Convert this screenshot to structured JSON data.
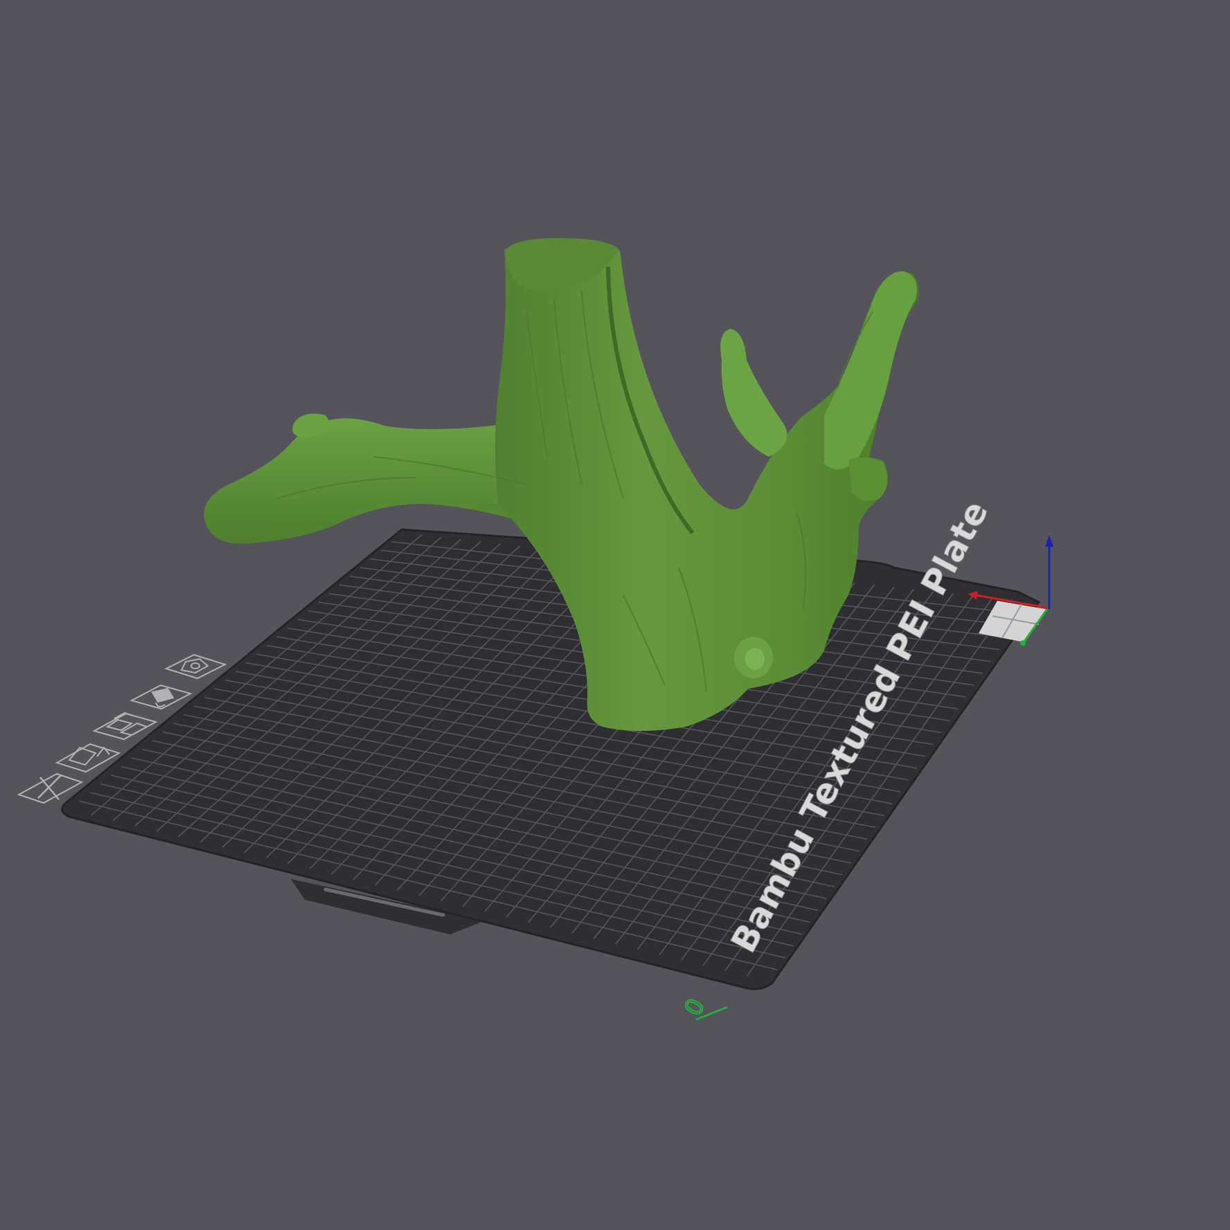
{
  "app": {
    "view": "3D prepare viewport"
  },
  "plate": {
    "name": "Bambu Textured PEI Plate",
    "origin_label": "0"
  },
  "plate_toolbar": [
    {
      "name": "delete-plate-button",
      "icon": "close-icon"
    },
    {
      "name": "arrange-plate-button",
      "icon": "arrange-icon"
    },
    {
      "name": "plate-settings-button",
      "icon": "layout-icon"
    },
    {
      "name": "lock-plate-button",
      "icon": "lock-icon"
    },
    {
      "name": "plate-options-button",
      "icon": "gear-icon"
    }
  ],
  "model": {
    "object": "tree trunk",
    "color": "#5e9038"
  },
  "colors": {
    "background": "#55545b",
    "plate": "#2f2e33",
    "grid": "#55545c",
    "axis_x": "#d21e1e",
    "axis_y": "#1fb53a",
    "axis_z": "#1b22b8"
  }
}
